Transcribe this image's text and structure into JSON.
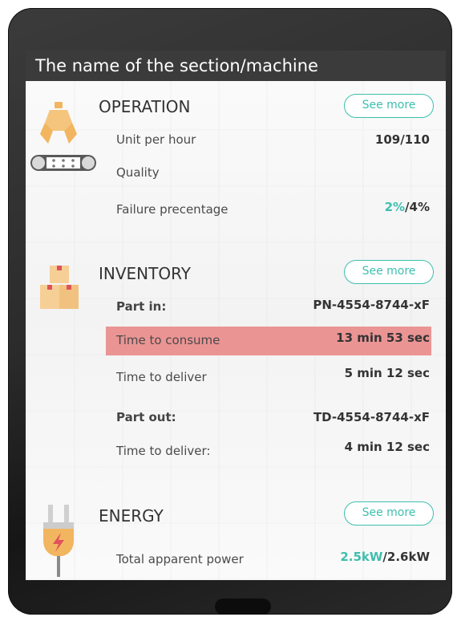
{
  "header": {
    "title": "The name of the section/machine"
  },
  "operation": {
    "title": "OPERATION",
    "see_more": "See more",
    "rows": {
      "unit_per_hour": {
        "label": "Unit per hour",
        "value": "109/110"
      },
      "quality": {
        "label": "Quality"
      },
      "failure": {
        "label": "Failure precentage",
        "value_accent": "2%",
        "value_rest": "/4%"
      }
    }
  },
  "inventory": {
    "title": "INVENTORY",
    "see_more": "See more",
    "rows": {
      "part_in": {
        "label": "Part in:",
        "value": "PN-4554-8744-xF"
      },
      "time_to_consume": {
        "label": "Time to consume",
        "value": "13 min  53 sec"
      },
      "time_to_deliver": {
        "label": "Time to deliver",
        "value": "5 min  12 sec"
      },
      "part_out": {
        "label": "Part out:",
        "value": "TD-4554-8744-xF"
      },
      "time_to_deliver_out": {
        "label": "Time to deliver:",
        "value": "4 min  12 sec"
      }
    }
  },
  "energy": {
    "title": "ENERGY",
    "see_more": "See more",
    "rows": {
      "total_power": {
        "label": "Total apparent power",
        "value_accent": "2.5kW",
        "value_rest": "/2.6kW"
      }
    }
  },
  "icons": {
    "operation": "robot-arm-conveyor-icon",
    "inventory": "boxes-icon",
    "energy": "power-plug-icon"
  },
  "colors": {
    "accent": "#3dbfae",
    "highlight": "#eb9494",
    "header_bg": "#3c3b3b",
    "icon_orange": "#f2b560",
    "icon_box": "#f5cf96",
    "icon_red": "#e0525a"
  }
}
